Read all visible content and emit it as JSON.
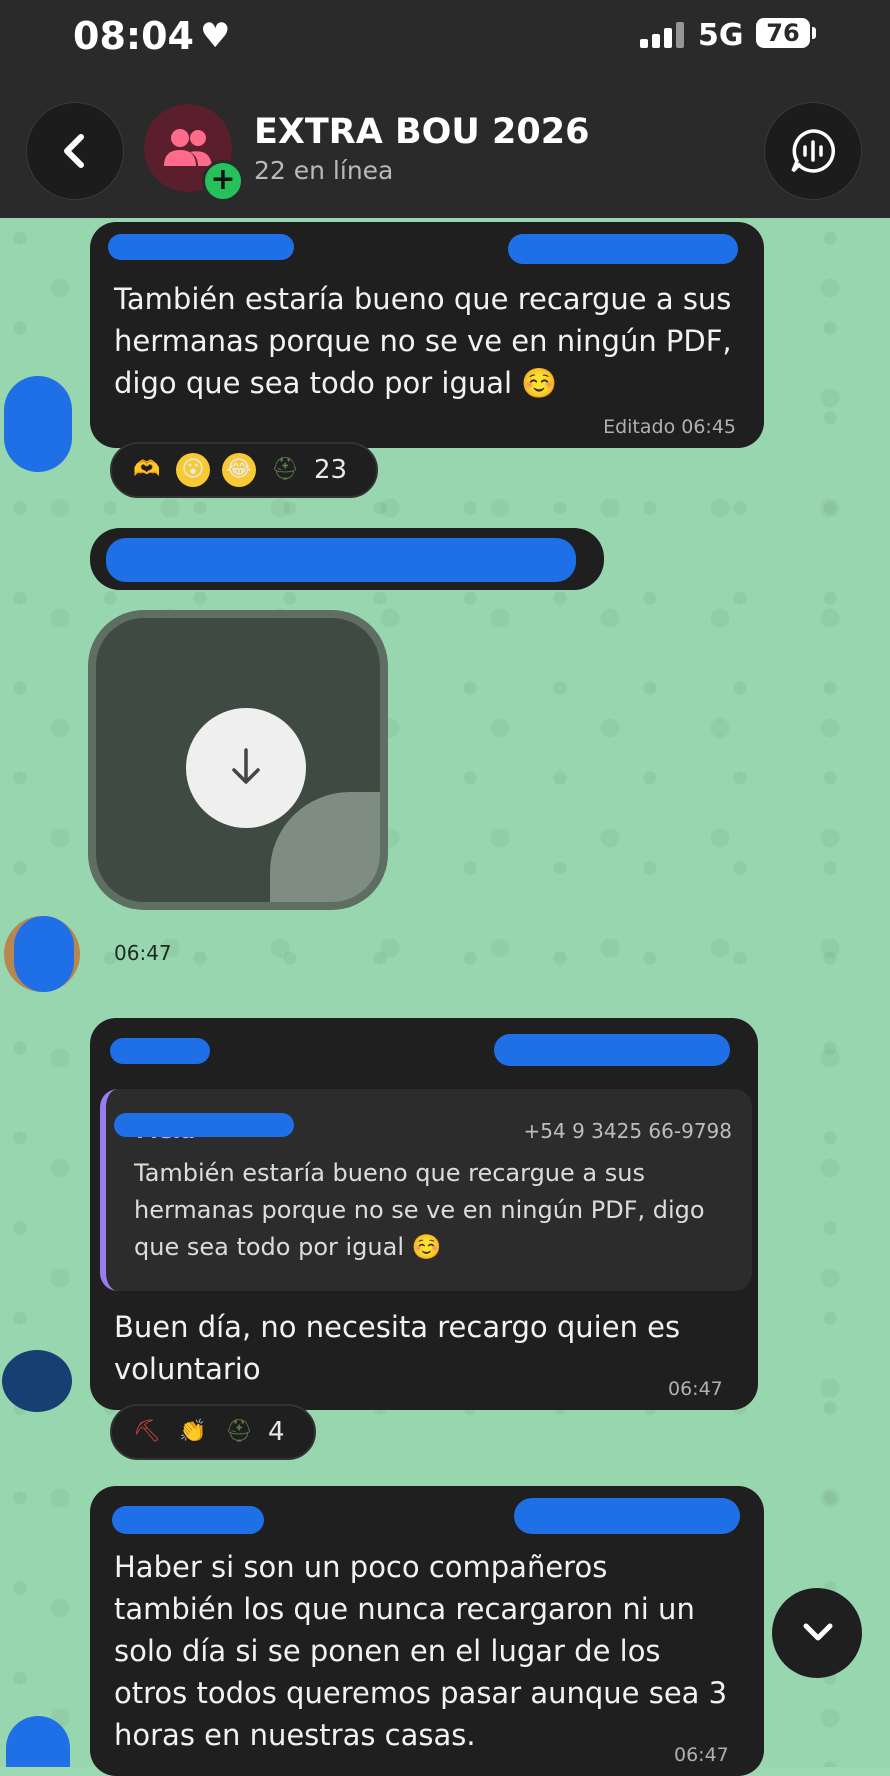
{
  "status_bar": {
    "time": "08:04",
    "network": "5G",
    "battery": "76"
  },
  "header": {
    "title": "EXTRA BOU 2026",
    "subtitle": "22 en línea"
  },
  "messages": [
    {
      "text": "También estaría bueno que recargue a sus hermanas porque no se ve en ningún PDF, digo que sea todo por igual ☺️",
      "time": "Editado 06:45",
      "reaction_count": "23"
    },
    {
      "time": "06:47"
    },
    {
      "quote_name": "Mela",
      "quote_phone": "+54 9 3425 66-9798",
      "quote_text": "También estaría bueno que recargue a sus hermanas porque no se ve en ningún PDF, digo que sea todo por igual ☺️",
      "text": "Buen día, no necesita recargo quien es voluntario",
      "time": "06:47",
      "reaction_count": "4"
    },
    {
      "text": "Haber si son un poco compañeros también los que nunca recargaron ni un solo día si se ponen en el lugar de los otros todos queremos pasar aunque sea 3 horas en nuestras casas.",
      "time": "06:47"
    }
  ]
}
